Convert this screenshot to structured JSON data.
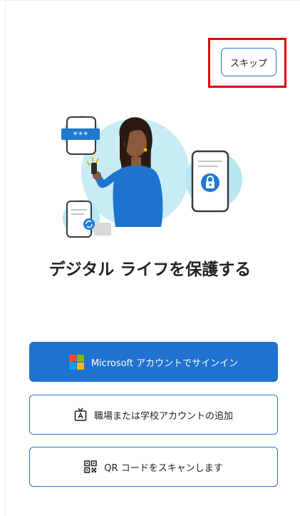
{
  "header": {
    "skip_label": "スキップ"
  },
  "main": {
    "headline": "デジタル ライフを保護する"
  },
  "actions": {
    "microsoft_signin_label": "Microsoft アカウントでサインイン",
    "work_school_label": "職場または学校アカウントの追加",
    "qr_scan_label": "QR コードをスキャンします"
  },
  "illustration": {
    "password_mask": "***"
  },
  "icons": {
    "skip": "none",
    "microsoft": "microsoft-logo-icon",
    "work_school": "id-badge-icon",
    "qr": "qr-code-icon"
  },
  "colors": {
    "accent": "#1f72d0",
    "highlight": "#e00000",
    "ms_red": "#f25022",
    "ms_green": "#7fba00",
    "ms_blue": "#00a4ef",
    "ms_yellow": "#ffb900"
  }
}
